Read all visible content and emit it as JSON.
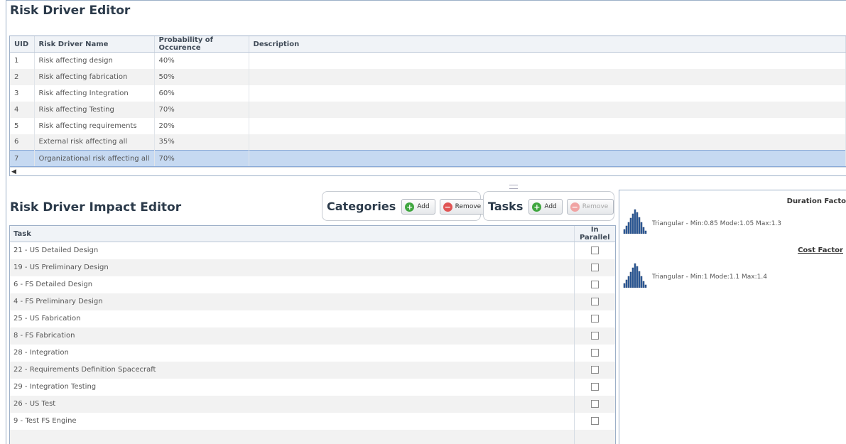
{
  "risk_driver_editor": {
    "title": "Risk Driver Editor",
    "columns": [
      "UID",
      "Risk Driver Name",
      "Probability of Occurence",
      "Description"
    ],
    "rows": [
      {
        "uid": "1",
        "name": "Risk affecting design",
        "prob": "40%",
        "desc": ""
      },
      {
        "uid": "2",
        "name": "Risk affecting fabrication",
        "prob": "50%",
        "desc": ""
      },
      {
        "uid": "3",
        "name": "Risk affecting Integration",
        "prob": "60%",
        "desc": ""
      },
      {
        "uid": "4",
        "name": "Risk affecting Testing",
        "prob": "70%",
        "desc": ""
      },
      {
        "uid": "5",
        "name": "Risk affecting requirements",
        "prob": "20%",
        "desc": ""
      },
      {
        "uid": "6",
        "name": "External risk affecting all",
        "prob": "35%",
        "desc": ""
      },
      {
        "uid": "7",
        "name": "Organizational risk affecting all",
        "prob": "70%",
        "desc": ""
      }
    ],
    "selected_row": 7
  },
  "impact_editor": {
    "title": "Risk Driver Impact Editor",
    "categories": {
      "label": "Categories",
      "add": "Add",
      "remove": "Remove"
    },
    "tasks_group": {
      "label": "Tasks",
      "add": "Add",
      "remove": "Remove"
    },
    "columns": [
      "Task",
      "In Parallel"
    ],
    "rows": [
      "21 - US Detailed Design",
      "19 - US Preliminary Design",
      "6 - FS Detailed Design",
      "4 - FS Preliminary Design",
      "25 - US Fabrication",
      "8 - FS Fabrication",
      "28 - Integration",
      "22 - Requirements Definition Spacecraft",
      "29 - Integration Testing",
      "26 - US Test",
      "9 - Test FS Engine"
    ]
  },
  "factors": {
    "duration_label": "Duration Facto",
    "duration_text": "Triangular - Min:0.85 Mode:1.05 Max:1.3",
    "cost_label": "Cost Factor",
    "cost_text": "Triangular - Min:1 Mode:1.1 Max:1.4"
  }
}
